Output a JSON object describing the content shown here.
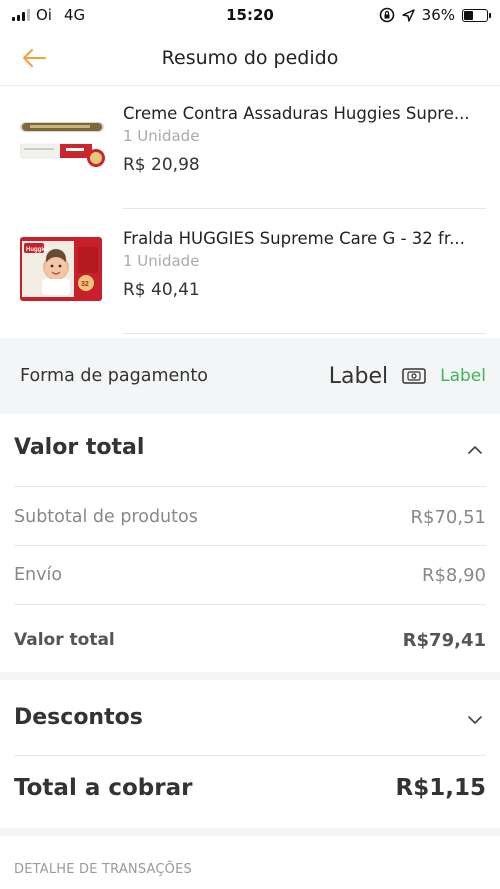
{
  "status_bar": {
    "carrier": "Oi",
    "network": "4G",
    "time": "15:20",
    "battery": "36%",
    "battery_level": 0.36
  },
  "header": {
    "title": "Resumo do pedido"
  },
  "products": [
    {
      "name": "Creme Contra Assaduras Huggies Supre...",
      "quantity": "1 Unidade",
      "price": "R$ 20,98"
    },
    {
      "name": "Fralda HUGGIES Supreme Care G - 32 fr...",
      "quantity": "1 Unidade",
      "price": "R$ 40,41",
      "image_badge": "32"
    }
  ],
  "product_image_text": {
    "brand": "Huggies"
  },
  "payment": {
    "label": "Forma de pagamento",
    "method": "Label",
    "action": "Label"
  },
  "total_section": {
    "title": "Valor total",
    "rows": [
      {
        "label": "Subtotal de produtos",
        "value": "R$70,51"
      },
      {
        "label": "Envío",
        "value": "R$8,90"
      },
      {
        "label": "Valor total",
        "value": "R$79,41"
      }
    ]
  },
  "discounts": {
    "title": "Descontos"
  },
  "charge": {
    "label": "Total a cobrar",
    "value": "R$1,15"
  },
  "transactions": {
    "label": "DETALHE DE TRANSAÇÕES"
  },
  "colors": {
    "accent_orange": "#f0a33a",
    "accent_green": "#3fb65a",
    "gray_background": "#f4f5f6"
  }
}
